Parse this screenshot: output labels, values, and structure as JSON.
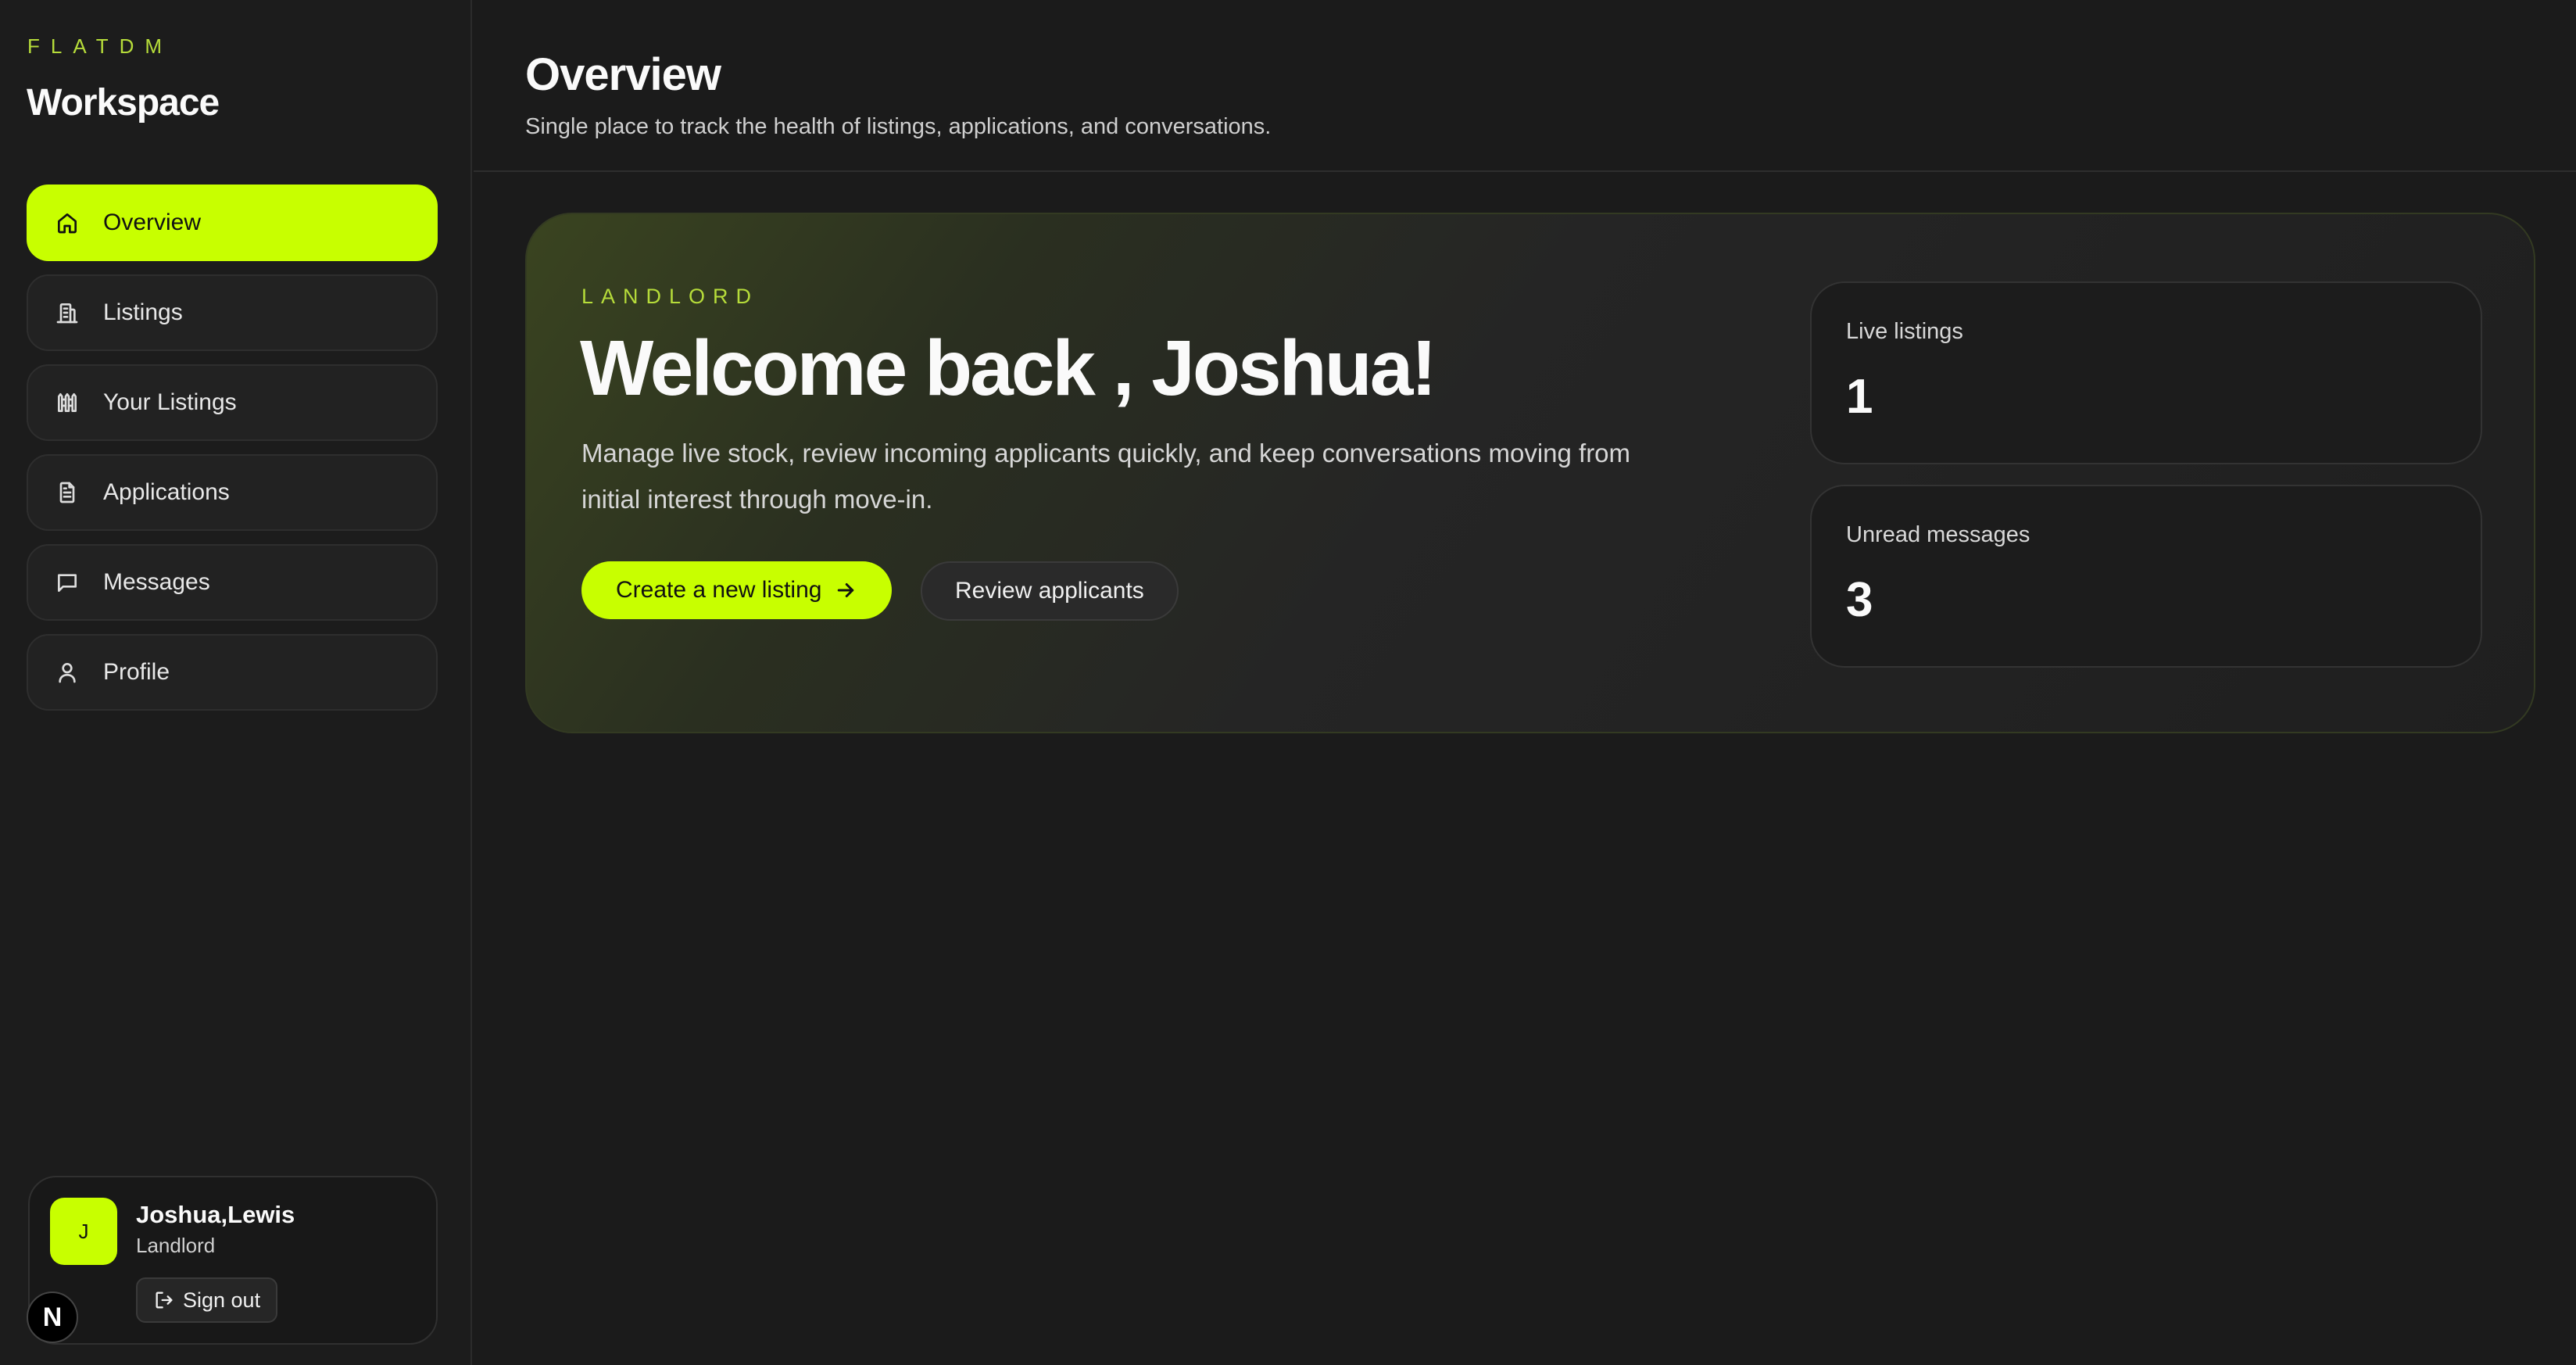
{
  "brand": "FLATDM",
  "workspace_title": "Workspace",
  "nav": [
    {
      "label": "Overview",
      "icon": "home-icon",
      "active": true
    },
    {
      "label": "Listings",
      "icon": "building-icon",
      "active": false
    },
    {
      "label": "Your Listings",
      "icon": "fence-icon",
      "active": false
    },
    {
      "label": "Applications",
      "icon": "file-text-icon",
      "active": false
    },
    {
      "label": "Messages",
      "icon": "message-square-icon",
      "active": false
    },
    {
      "label": "Profile",
      "icon": "user-icon",
      "active": false
    }
  ],
  "user": {
    "avatar_initial": "J",
    "name": "Joshua,Lewis",
    "role": "Landlord",
    "sign_out_label": "Sign out"
  },
  "next_badge": "N",
  "header": {
    "title": "Overview",
    "subtitle": "Single place to track the health of listings, applications, and conversations."
  },
  "hero": {
    "eyebrow": "LANDLORD",
    "welcome": "Welcome back , Joshua!",
    "description": "Manage live stock, review incoming applicants quickly, and keep conversations moving from initial interest through move-in.",
    "primary_button": "Create a new listing",
    "secondary_button": "Review applicants"
  },
  "stats": [
    {
      "label": "Live listings",
      "value": "1"
    },
    {
      "label": "Unread messages",
      "value": "3"
    }
  ],
  "colors": {
    "accent": "#c8ff00",
    "background": "#1b1b1b",
    "eyebrow": "#b6dc3a"
  }
}
